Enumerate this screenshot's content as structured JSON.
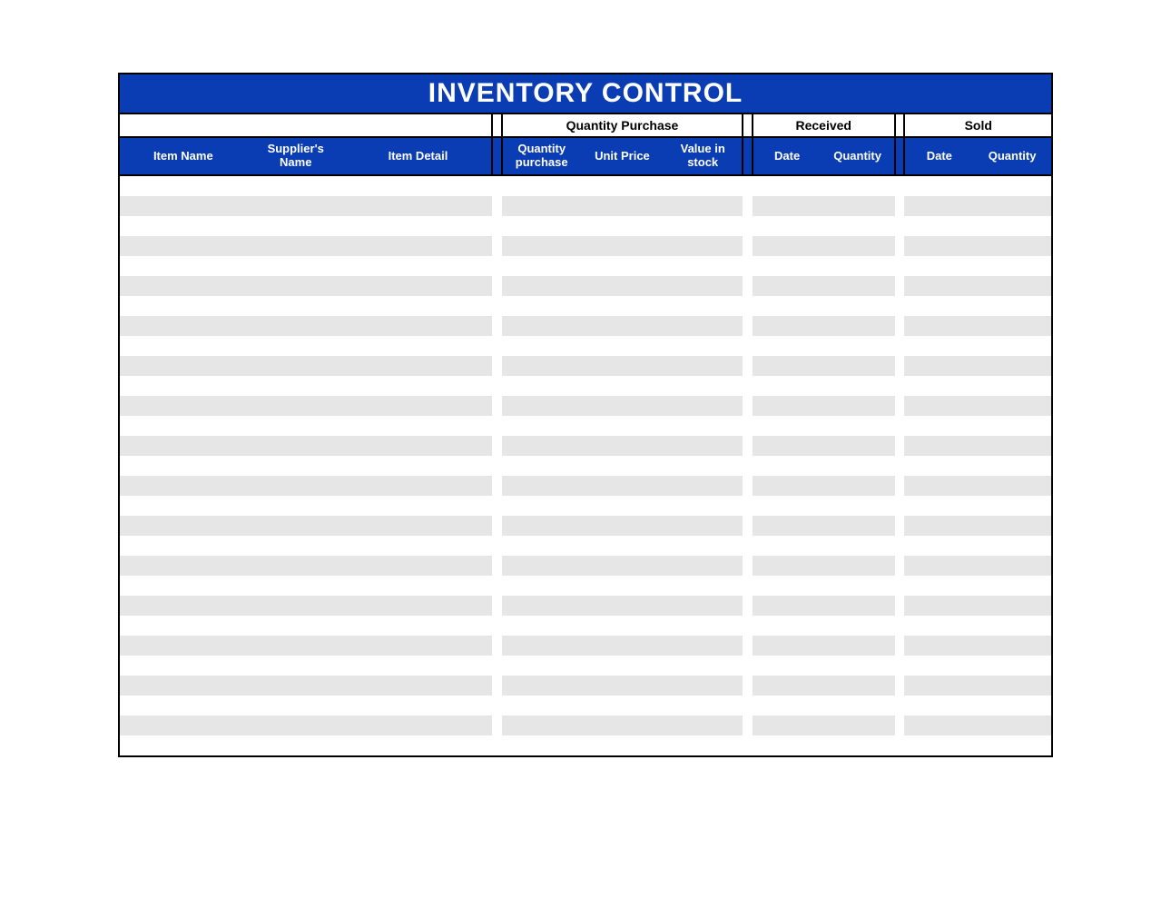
{
  "title": "INVENTORY CONTROL",
  "groups": {
    "blank": "",
    "quantity_purchase": "Quantity Purchase",
    "received": "Received",
    "sold": "Sold"
  },
  "columns": {
    "item_name": "Item Name",
    "suppliers_name": "Supplier's Name",
    "item_detail": "Item Detail",
    "quantity_purchase": "Quantity purchase",
    "unit_price": "Unit Price",
    "value_in_stock": "Value in stock",
    "received_date": "Date",
    "received_quantity": "Quantity",
    "sold_date": "Date",
    "sold_quantity": "Quantity"
  },
  "rows": [
    {
      "item_name": "",
      "suppliers_name": "",
      "item_detail": "",
      "quantity_purchase": "",
      "unit_price": "",
      "value_in_stock": "",
      "received_date": "",
      "received_quantity": "",
      "sold_date": "",
      "sold_quantity": ""
    },
    {
      "item_name": "",
      "suppliers_name": "",
      "item_detail": "",
      "quantity_purchase": "",
      "unit_price": "",
      "value_in_stock": "",
      "received_date": "",
      "received_quantity": "",
      "sold_date": "",
      "sold_quantity": ""
    },
    {
      "item_name": "",
      "suppliers_name": "",
      "item_detail": "",
      "quantity_purchase": "",
      "unit_price": "",
      "value_in_stock": "",
      "received_date": "",
      "received_quantity": "",
      "sold_date": "",
      "sold_quantity": ""
    },
    {
      "item_name": "",
      "suppliers_name": "",
      "item_detail": "",
      "quantity_purchase": "",
      "unit_price": "",
      "value_in_stock": "",
      "received_date": "",
      "received_quantity": "",
      "sold_date": "",
      "sold_quantity": ""
    },
    {
      "item_name": "",
      "suppliers_name": "",
      "item_detail": "",
      "quantity_purchase": "",
      "unit_price": "",
      "value_in_stock": "",
      "received_date": "",
      "received_quantity": "",
      "sold_date": "",
      "sold_quantity": ""
    },
    {
      "item_name": "",
      "suppliers_name": "",
      "item_detail": "",
      "quantity_purchase": "",
      "unit_price": "",
      "value_in_stock": "",
      "received_date": "",
      "received_quantity": "",
      "sold_date": "",
      "sold_quantity": ""
    },
    {
      "item_name": "",
      "suppliers_name": "",
      "item_detail": "",
      "quantity_purchase": "",
      "unit_price": "",
      "value_in_stock": "",
      "received_date": "",
      "received_quantity": "",
      "sold_date": "",
      "sold_quantity": ""
    },
    {
      "item_name": "",
      "suppliers_name": "",
      "item_detail": "",
      "quantity_purchase": "",
      "unit_price": "",
      "value_in_stock": "",
      "received_date": "",
      "received_quantity": "",
      "sold_date": "",
      "sold_quantity": ""
    },
    {
      "item_name": "",
      "suppliers_name": "",
      "item_detail": "",
      "quantity_purchase": "",
      "unit_price": "",
      "value_in_stock": "",
      "received_date": "",
      "received_quantity": "",
      "sold_date": "",
      "sold_quantity": ""
    },
    {
      "item_name": "",
      "suppliers_name": "",
      "item_detail": "",
      "quantity_purchase": "",
      "unit_price": "",
      "value_in_stock": "",
      "received_date": "",
      "received_quantity": "",
      "sold_date": "",
      "sold_quantity": ""
    },
    {
      "item_name": "",
      "suppliers_name": "",
      "item_detail": "",
      "quantity_purchase": "",
      "unit_price": "",
      "value_in_stock": "",
      "received_date": "",
      "received_quantity": "",
      "sold_date": "",
      "sold_quantity": ""
    },
    {
      "item_name": "",
      "suppliers_name": "",
      "item_detail": "",
      "quantity_purchase": "",
      "unit_price": "",
      "value_in_stock": "",
      "received_date": "",
      "received_quantity": "",
      "sold_date": "",
      "sold_quantity": ""
    },
    {
      "item_name": "",
      "suppliers_name": "",
      "item_detail": "",
      "quantity_purchase": "",
      "unit_price": "",
      "value_in_stock": "",
      "received_date": "",
      "received_quantity": "",
      "sold_date": "",
      "sold_quantity": ""
    },
    {
      "item_name": "",
      "suppliers_name": "",
      "item_detail": "",
      "quantity_purchase": "",
      "unit_price": "",
      "value_in_stock": "",
      "received_date": "",
      "received_quantity": "",
      "sold_date": "",
      "sold_quantity": ""
    },
    {
      "item_name": "",
      "suppliers_name": "",
      "item_detail": "",
      "quantity_purchase": "",
      "unit_price": "",
      "value_in_stock": "",
      "received_date": "",
      "received_quantity": "",
      "sold_date": "",
      "sold_quantity": ""
    },
    {
      "item_name": "",
      "suppliers_name": "",
      "item_detail": "",
      "quantity_purchase": "",
      "unit_price": "",
      "value_in_stock": "",
      "received_date": "",
      "received_quantity": "",
      "sold_date": "",
      "sold_quantity": ""
    },
    {
      "item_name": "",
      "suppliers_name": "",
      "item_detail": "",
      "quantity_purchase": "",
      "unit_price": "",
      "value_in_stock": "",
      "received_date": "",
      "received_quantity": "",
      "sold_date": "",
      "sold_quantity": ""
    },
    {
      "item_name": "",
      "suppliers_name": "",
      "item_detail": "",
      "quantity_purchase": "",
      "unit_price": "",
      "value_in_stock": "",
      "received_date": "",
      "received_quantity": "",
      "sold_date": "",
      "sold_quantity": ""
    },
    {
      "item_name": "",
      "suppliers_name": "",
      "item_detail": "",
      "quantity_purchase": "",
      "unit_price": "",
      "value_in_stock": "",
      "received_date": "",
      "received_quantity": "",
      "sold_date": "",
      "sold_quantity": ""
    },
    {
      "item_name": "",
      "suppliers_name": "",
      "item_detail": "",
      "quantity_purchase": "",
      "unit_price": "",
      "value_in_stock": "",
      "received_date": "",
      "received_quantity": "",
      "sold_date": "",
      "sold_quantity": ""
    },
    {
      "item_name": "",
      "suppliers_name": "",
      "item_detail": "",
      "quantity_purchase": "",
      "unit_price": "",
      "value_in_stock": "",
      "received_date": "",
      "received_quantity": "",
      "sold_date": "",
      "sold_quantity": ""
    },
    {
      "item_name": "",
      "suppliers_name": "",
      "item_detail": "",
      "quantity_purchase": "",
      "unit_price": "",
      "value_in_stock": "",
      "received_date": "",
      "received_quantity": "",
      "sold_date": "",
      "sold_quantity": ""
    },
    {
      "item_name": "",
      "suppliers_name": "",
      "item_detail": "",
      "quantity_purchase": "",
      "unit_price": "",
      "value_in_stock": "",
      "received_date": "",
      "received_quantity": "",
      "sold_date": "",
      "sold_quantity": ""
    },
    {
      "item_name": "",
      "suppliers_name": "",
      "item_detail": "",
      "quantity_purchase": "",
      "unit_price": "",
      "value_in_stock": "",
      "received_date": "",
      "received_quantity": "",
      "sold_date": "",
      "sold_quantity": ""
    },
    {
      "item_name": "",
      "suppliers_name": "",
      "item_detail": "",
      "quantity_purchase": "",
      "unit_price": "",
      "value_in_stock": "",
      "received_date": "",
      "received_quantity": "",
      "sold_date": "",
      "sold_quantity": ""
    },
    {
      "item_name": "",
      "suppliers_name": "",
      "item_detail": "",
      "quantity_purchase": "",
      "unit_price": "",
      "value_in_stock": "",
      "received_date": "",
      "received_quantity": "",
      "sold_date": "",
      "sold_quantity": ""
    },
    {
      "item_name": "",
      "suppliers_name": "",
      "item_detail": "",
      "quantity_purchase": "",
      "unit_price": "",
      "value_in_stock": "",
      "received_date": "",
      "received_quantity": "",
      "sold_date": "",
      "sold_quantity": ""
    },
    {
      "item_name": "",
      "suppliers_name": "",
      "item_detail": "",
      "quantity_purchase": "",
      "unit_price": "",
      "value_in_stock": "",
      "received_date": "",
      "received_quantity": "",
      "sold_date": "",
      "sold_quantity": ""
    },
    {
      "item_name": "",
      "suppliers_name": "",
      "item_detail": "",
      "quantity_purchase": "",
      "unit_price": "",
      "value_in_stock": "",
      "received_date": "",
      "received_quantity": "",
      "sold_date": "",
      "sold_quantity": ""
    }
  ]
}
